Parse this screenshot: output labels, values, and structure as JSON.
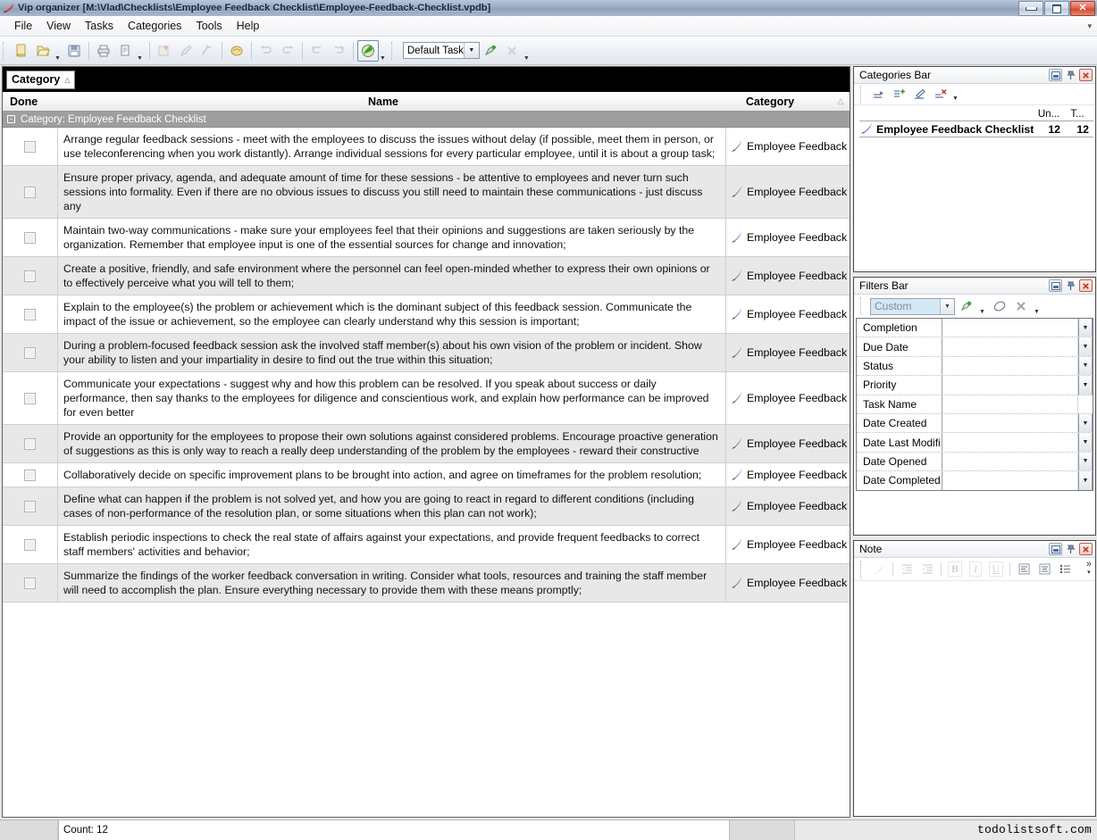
{
  "window": {
    "title": "Vip organizer [M:\\Vlad\\Checklists\\Employee Feedback Checklist\\Employee-Feedback-Checklist.vpdb]",
    "app_icon": "feather-pen-icon",
    "controls": {
      "minimize": "–",
      "maximize": "□",
      "close": "✕"
    }
  },
  "menu": {
    "items": [
      {
        "label": "File"
      },
      {
        "label": "View"
      },
      {
        "label": "Tasks"
      },
      {
        "label": "Categories"
      },
      {
        "label": "Tools"
      },
      {
        "label": "Help"
      }
    ],
    "overflow": "▾"
  },
  "toolbar": {
    "buttons": [
      {
        "name": "new-task-button",
        "icon": "note-icon",
        "disabled": false
      },
      {
        "name": "open-task-button",
        "icon": "folder-open-icon",
        "disabled": false
      },
      {
        "name": "open-dropdown",
        "icon": "chevron-down-icon",
        "disabled": false
      },
      {
        "name": "save-button",
        "icon": "save-icon",
        "disabled": false
      },
      {
        "name": "print-button",
        "icon": "printer-icon",
        "disabled": false
      },
      {
        "name": "print-preview-button",
        "icon": "print-preview-icon",
        "disabled": false
      },
      {
        "name": "print-dropdown",
        "icon": "chevron-down-icon",
        "disabled": false
      },
      {
        "name": "add-category-button",
        "icon": "add-category-icon",
        "disabled": true
      },
      {
        "name": "edit-button",
        "icon": "pencil-icon",
        "disabled": true
      },
      {
        "name": "delete-button",
        "icon": "delete-icon",
        "disabled": true
      },
      {
        "name": "properties-button",
        "icon": "properties-icon",
        "disabled": false
      },
      {
        "name": "undo-button",
        "icon": "undo-icon",
        "disabled": true
      },
      {
        "name": "redo-button",
        "icon": "redo-icon",
        "disabled": true
      },
      {
        "name": "back-button",
        "icon": "back-icon",
        "disabled": true
      },
      {
        "name": "forward-button",
        "icon": "forward-icon",
        "disabled": true
      },
      {
        "name": "run-button",
        "icon": "green-arrow-icon",
        "disabled": false
      },
      {
        "name": "run-dropdown",
        "icon": "chevron-down-icon",
        "disabled": false
      }
    ],
    "task_combo": {
      "value": "Default Task",
      "arrow": "▼"
    },
    "apply_filter_button": "apply-filter-icon",
    "clear_filter_button": "clear-filter-icon",
    "more_button": "▾"
  },
  "grid": {
    "group_chip": {
      "label": "Category",
      "sort": "△"
    },
    "columns": [
      {
        "key": "done",
        "label": "Done"
      },
      {
        "key": "name",
        "label": "Name"
      },
      {
        "key": "category",
        "label": "Category",
        "sort": "△"
      }
    ],
    "group_header": {
      "expander": "-",
      "label": "Category: Employee Feedback Checklist"
    },
    "rows": [
      {
        "done": false,
        "name": "Arrange regular feedback sessions - meet with the employees to discuss the issues without delay (if possible, meet them in person, or use teleconferencing when you work distantly). Arrange individual sessions for every particular employee, until it is about a group task;",
        "category": "Employee Feedback"
      },
      {
        "done": false,
        "name": "Ensure proper privacy, agenda, and adequate amount of time for these sessions - be attentive to employees and never turn such sessions into formality. Even if there are no obvious issues to discuss you still need to maintain these communications - just discuss any",
        "category": "Employee Feedback"
      },
      {
        "done": false,
        "name": "Maintain two-way communications - make sure your employees feel that their opinions and suggestions are taken seriously by the organization. Remember that employee input is one of the essential sources for change and innovation;",
        "category": "Employee Feedback"
      },
      {
        "done": false,
        "name": "Create a positive, friendly, and safe environment where the personnel can feel open-minded whether to express their own opinions or to effectively perceive what you will tell to them;",
        "category": "Employee Feedback"
      },
      {
        "done": false,
        "name": "Explain to the employee(s) the problem or achievement which is the dominant subject of this feedback session. Communicate the impact of the issue or achievement, so the employee can clearly understand why this session is important;",
        "category": "Employee Feedback"
      },
      {
        "done": false,
        "name": "During a problem-focused feedback session ask the involved staff member(s) about his own vision of the problem or incident. Show your ability to listen and your impartiality in desire to find out the true within this situation;",
        "category": "Employee Feedback"
      },
      {
        "done": false,
        "name": "Communicate your expectations - suggest why and how this problem can be resolved. If you speak about success or daily performance, then say thanks to the employees for diligence and conscientious work, and explain how performance can be improved for even better",
        "category": "Employee Feedback"
      },
      {
        "done": false,
        "name": "Provide an opportunity for the employees to propose their own solutions against considered problems. Encourage proactive generation of suggestions as this is only way to reach a really deep understanding of the problem by the employees - reward their constructive",
        "category": "Employee Feedback"
      },
      {
        "done": false,
        "name": "Collaboratively decide on specific improvement plans to be brought into action, and agree on timeframes for the problem resolution;",
        "category": "Employee Feedback"
      },
      {
        "done": false,
        "name": "Define what can happen if the problem is not solved yet, and how you are going to react in regard to different conditions (including cases of non-performance of the resolution plan, or some situations when this plan can not work);",
        "category": "Employee Feedback"
      },
      {
        "done": false,
        "name": "Establish periodic inspections to check the real state of affairs against your expectations, and provide frequent feedbacks to correct staff members' activities and behavior;",
        "category": "Employee Feedback"
      },
      {
        "done": false,
        "name": "Summarize the findings of the worker feedback conversation in writing. Consider what tools, resources and training the staff member will need to accomplish the plan. Ensure everything necessary to provide them with these means promptly;",
        "category": "Employee Feedback"
      }
    ]
  },
  "categories_panel": {
    "title": "Categories Bar",
    "toolbar": [
      {
        "name": "new-category-button",
        "icon": "new-category-icon"
      },
      {
        "name": "new-subcategory-button",
        "icon": "new-subcategory-icon"
      },
      {
        "name": "edit-category-button",
        "icon": "edit-category-icon"
      },
      {
        "name": "delete-category-button",
        "icon": "delete-category-icon"
      },
      {
        "name": "categories-overflow",
        "icon": "chevron-down-icon"
      }
    ],
    "columns": [
      "Un...",
      "T..."
    ],
    "items": [
      {
        "icon": "feather-pen-icon",
        "name": "Employee Feedback Checklist",
        "uncompleted": "12",
        "total": "12"
      }
    ]
  },
  "filters_panel": {
    "title": "Filters Bar",
    "preset": {
      "value": "Custom",
      "arrow": "▼"
    },
    "toolbar": [
      {
        "name": "apply-filter-button",
        "icon": "apply-filter-icon"
      },
      {
        "name": "filter-dropdown",
        "icon": "chevron-down-icon"
      },
      {
        "name": "clear-filter-button",
        "icon": "eraser-icon"
      },
      {
        "name": "remove-filter-button",
        "icon": "remove-filter-icon"
      },
      {
        "name": "filters-overflow",
        "icon": "chevron-down-icon"
      }
    ],
    "rows": [
      {
        "label": "Completion",
        "value": "",
        "has_dropdown": true
      },
      {
        "label": "Due Date",
        "value": "",
        "has_dropdown": true
      },
      {
        "label": "Status",
        "value": "",
        "has_dropdown": true
      },
      {
        "label": "Priority",
        "value": "",
        "has_dropdown": true
      },
      {
        "label": "Task Name",
        "value": "",
        "has_dropdown": false
      },
      {
        "label": "Date Created",
        "value": "",
        "has_dropdown": true
      },
      {
        "label": "Date Last Modifi",
        "value": "",
        "has_dropdown": true
      },
      {
        "label": "Date Opened",
        "value": "",
        "has_dropdown": true
      },
      {
        "label": "Date Completed",
        "value": "",
        "has_dropdown": true
      }
    ]
  },
  "note_panel": {
    "title": "Note",
    "toolbar": [
      {
        "name": "note-edit-button",
        "icon": "pen-icon"
      },
      {
        "name": "indent-decrease-button",
        "icon": "indent-decrease-icon"
      },
      {
        "name": "indent-increase-button",
        "icon": "indent-increase-icon"
      },
      {
        "name": "bold-button",
        "icon": "bold-icon",
        "label": "B"
      },
      {
        "name": "italic-button",
        "icon": "italic-icon",
        "label": "I"
      },
      {
        "name": "underline-button",
        "icon": "underline-icon",
        "label": "U"
      },
      {
        "name": "align-left-button",
        "icon": "align-left-icon"
      },
      {
        "name": "align-center-button",
        "icon": "align-center-icon"
      },
      {
        "name": "bullet-list-button",
        "icon": "bullet-list-icon"
      }
    ],
    "overflow": "»",
    "overflow_caret": "▾",
    "content": ""
  },
  "statusbar": {
    "count": "Count: 12",
    "watermark": "todolistsoft.com"
  }
}
